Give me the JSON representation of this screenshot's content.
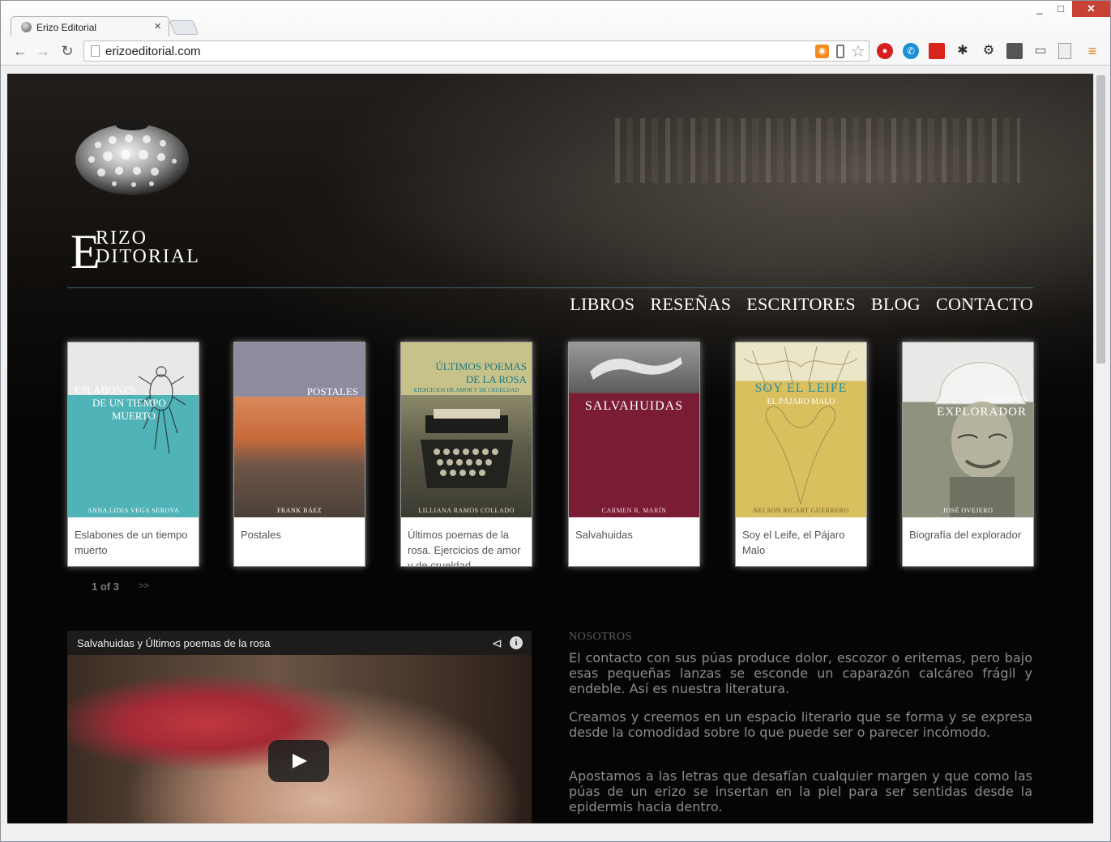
{
  "browser": {
    "tab_title": "Erizo Editorial",
    "tab_close": "×",
    "url": "erizoeditorial.com",
    "window_controls": {
      "minimize": "_",
      "maximize": "□",
      "close": "✕"
    }
  },
  "site": {
    "brand": {
      "initial": "E",
      "line1": "RIZO",
      "line2": "DITORIAL"
    },
    "nav": [
      "LIBROS",
      "RESEÑAS",
      "ESCRITORES",
      "BLOG",
      "CONTACTO"
    ],
    "books": [
      {
        "cover_title": "Eslabones de un tiempo muerto",
        "cover_title_lines": [
          "Eslabones",
          "de un tiempo",
          "muerto"
        ],
        "cover_author": "Anna Lidia Vega Serova",
        "caption": "Eslabones de un tiempo muerto",
        "colors": {
          "top": "#e8e8e6",
          "bottom": "#4fb3b8",
          "title": "#ffffff"
        }
      },
      {
        "cover_title": "Postales",
        "cover_author": "Frank Báez",
        "caption": "Postales",
        "colors": {
          "top": "#8f8a9e",
          "bottom": "#c86a3a",
          "title": "#ffffff"
        }
      },
      {
        "cover_title": "Últimos poemas de la rosa",
        "cover_title_lines": [
          "Últimos poemas",
          "de la rosa"
        ],
        "cover_subtitle": "Ejercicios de amor y de crueldad",
        "cover_author": "Lilliana Ramos Collado",
        "caption": "Últimos poemas de la rosa. Ejercicios de amor y de crueldad",
        "colors": {
          "top": "#c7c28a",
          "bottom": "#4a4a3a",
          "title": "#1d7a86"
        }
      },
      {
        "cover_title": "Salvahuidas",
        "cover_author": "Carmen R. Marín",
        "caption": "Salvahuidas",
        "colors": {
          "top": "#6f6f6f",
          "bottom": "#7b1c35",
          "title": "#ffffff"
        }
      },
      {
        "cover_title": "Soy el Leife",
        "cover_subtitle": "El pájaro malo",
        "cover_author": "Nelson Ricart Guerrero",
        "caption": "Soy el Leife, el Pájaro Malo",
        "colors": {
          "top": "#ece6c8",
          "bottom": "#d9bf5e",
          "title": "#2b8fa0"
        }
      },
      {
        "cover_title": "Explorador",
        "cover_title_prefix": "Biografía del",
        "cover_author": "José Ovejero",
        "caption": "Biografía del explorador",
        "colors": {
          "top": "#e9e9e7",
          "bottom": "#8f927e",
          "title": "#ffffff"
        }
      }
    ],
    "pager": {
      "label": "1 of 3",
      "next": ">>"
    },
    "video": {
      "title": "Salvahuidas y Últimos poemas de la rosa",
      "info": "i"
    },
    "about": {
      "heading": "NOSOTROS",
      "paragraphs": [
        "El contacto con sus púas produce dolor, escozor o eritemas, pero bajo esas pequeñas lanzas se esconde un caparazón calcáreo frágil y endeble. Así es nuestra literatura.",
        "Creamos y creemos en un espacio literario que se forma y se expresa desde la comodidad sobre lo que puede ser o parecer incómodo.",
        "Apostamos a las letras que desafían cualquier margen y que como las púas de un erizo se insertan en la piel para ser sentidas desde la epidermis hacia dentro."
      ]
    }
  }
}
